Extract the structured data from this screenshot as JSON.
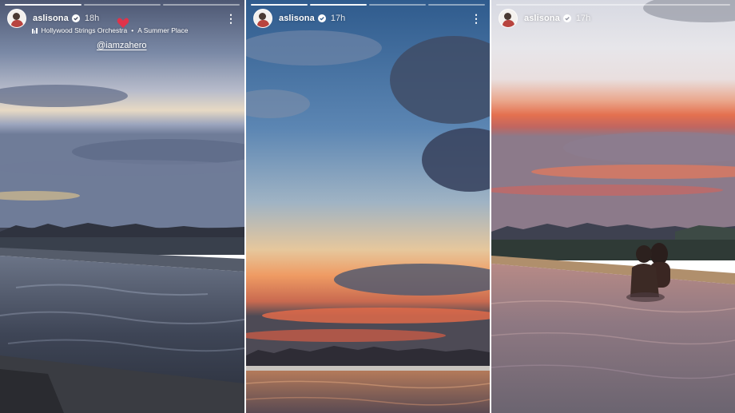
{
  "stories": [
    {
      "username": "aslisona",
      "time": "18h",
      "music": {
        "artist": "Hollywood Strings Orchestra",
        "separator": "•",
        "track": "A Summer Place"
      },
      "mention": "@iamzahero",
      "progress_segments": 3,
      "progress_done": 1
    },
    {
      "username": "aslisona",
      "time": "17h",
      "progress_segments": 4,
      "progress_done": 2
    },
    {
      "username": "aslisona",
      "time": "17h",
      "progress_segments": 1,
      "progress_done": 0
    }
  ],
  "icons": {
    "verified": "verified-badge-icon",
    "more": "more-options-icon",
    "music": "music-note-icon",
    "heart": "heart-sticker-icon"
  },
  "colors": {
    "verified_badge": "#ffffff",
    "heart": "#e0334a"
  }
}
